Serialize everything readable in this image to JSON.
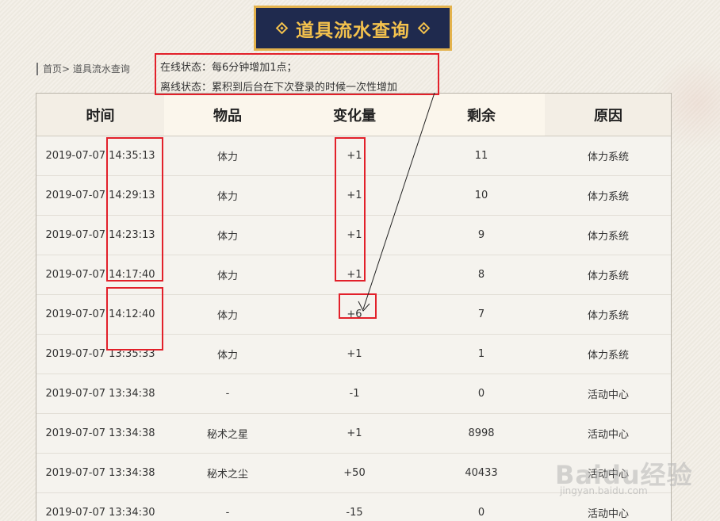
{
  "banner": {
    "title": "道具流水查询"
  },
  "breadcrumb": {
    "home": "首页",
    "separator": ">",
    "current": "道具流水查询"
  },
  "note": {
    "online": "在线状态：每6分钟增加1点；",
    "offline": "离线状态：累积到后台在下次登录的时候一次性增加"
  },
  "table": {
    "headers": [
      "时间",
      "物品",
      "变化量",
      "剩余",
      "原因"
    ],
    "rows": [
      {
        "time": "2019-07-07 14:35:13",
        "item": "体力",
        "change": "+1",
        "remain": "11",
        "reason": "体力系统"
      },
      {
        "time": "2019-07-07 14:29:13",
        "item": "体力",
        "change": "+1",
        "remain": "10",
        "reason": "体力系统"
      },
      {
        "time": "2019-07-07 14:23:13",
        "item": "体力",
        "change": "+1",
        "remain": "9",
        "reason": "体力系统"
      },
      {
        "time": "2019-07-07 14:17:40",
        "item": "体力",
        "change": "+1",
        "remain": "8",
        "reason": "体力系统"
      },
      {
        "time": "2019-07-07 14:12:40",
        "item": "体力",
        "change": "+6",
        "remain": "7",
        "reason": "体力系统"
      },
      {
        "time": "2019-07-07 13:35:33",
        "item": "体力",
        "change": "+1",
        "remain": "1",
        "reason": "体力系统"
      },
      {
        "time": "2019-07-07 13:34:38",
        "item": "-",
        "change": "-1",
        "remain": "0",
        "reason": "活动中心"
      },
      {
        "time": "2019-07-07 13:34:38",
        "item": "秘术之星",
        "change": "+1",
        "remain": "8998",
        "reason": "活动中心"
      },
      {
        "time": "2019-07-07 13:34:38",
        "item": "秘术之尘",
        "change": "+50",
        "remain": "40433",
        "reason": "活动中心"
      },
      {
        "time": "2019-07-07 13:34:30",
        "item": "-",
        "change": "-15",
        "remain": "0",
        "reason": "活动中心"
      }
    ]
  },
  "watermark": {
    "logo": "Baidu经验",
    "url": "jingyan.baidu.com"
  },
  "colors": {
    "banner_bg": "#1f2a4e",
    "banner_gold": "#f4c24d",
    "highlight_red": "#e2202a"
  }
}
